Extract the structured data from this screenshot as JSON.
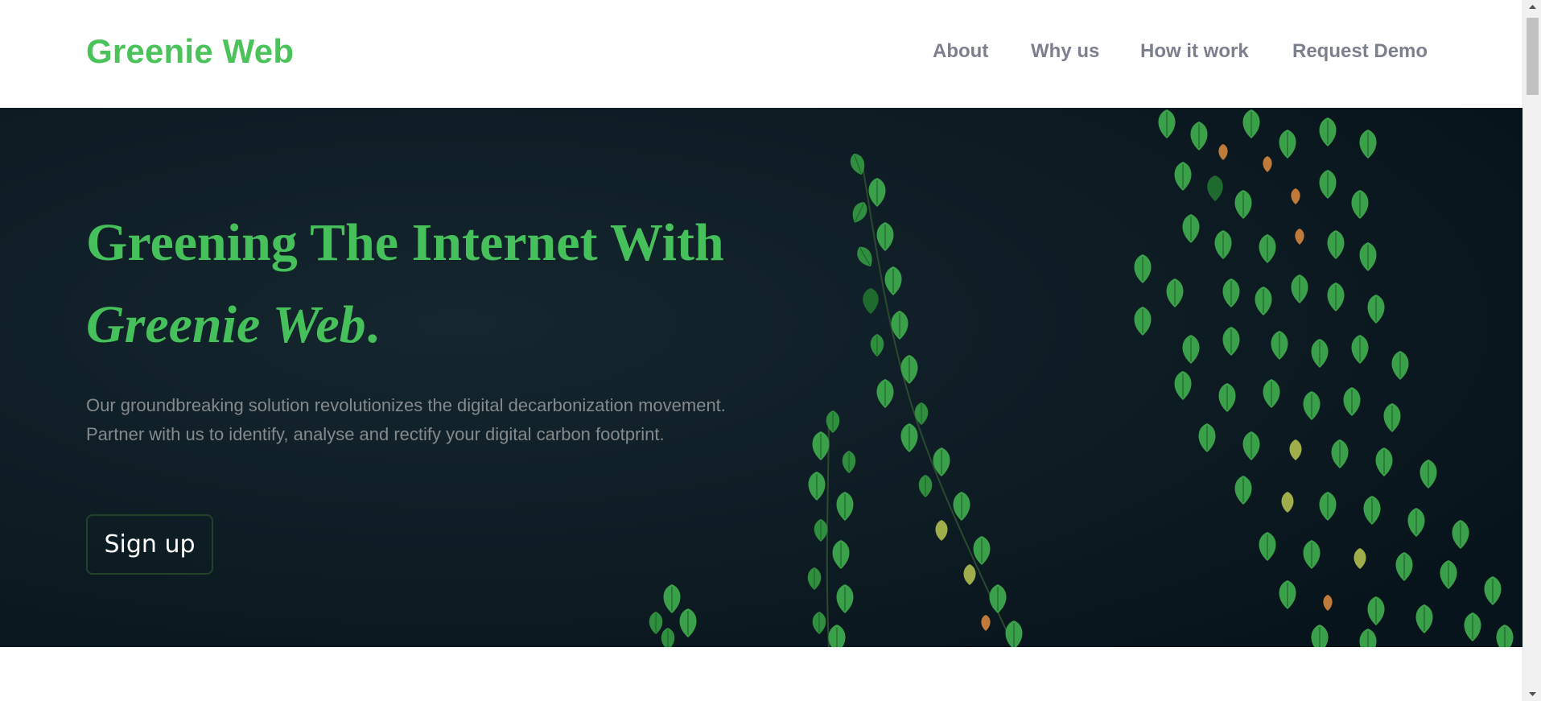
{
  "header": {
    "logo": "Greenie Web",
    "nav": [
      {
        "label": "About"
      },
      {
        "label": "Why us"
      },
      {
        "label": "How it work"
      },
      {
        "label": "Request Demo"
      }
    ]
  },
  "hero": {
    "title_line1": "Greening The Internet With",
    "title_line2": "Greenie Web",
    "title_line2_punct": ".",
    "description": "Our groundbreaking solution revolutionizes the digital decarbonization movement. Partner with us to identify, analyse and rectify your digital carbon footprint.",
    "signup_label": "Sign up",
    "background_image": "ivy-leaves-on-dark-wall"
  },
  "colors": {
    "brand_green": "#4cc35a",
    "nav_text": "#7b7f8e",
    "hero_bg": "#0c1a22"
  }
}
